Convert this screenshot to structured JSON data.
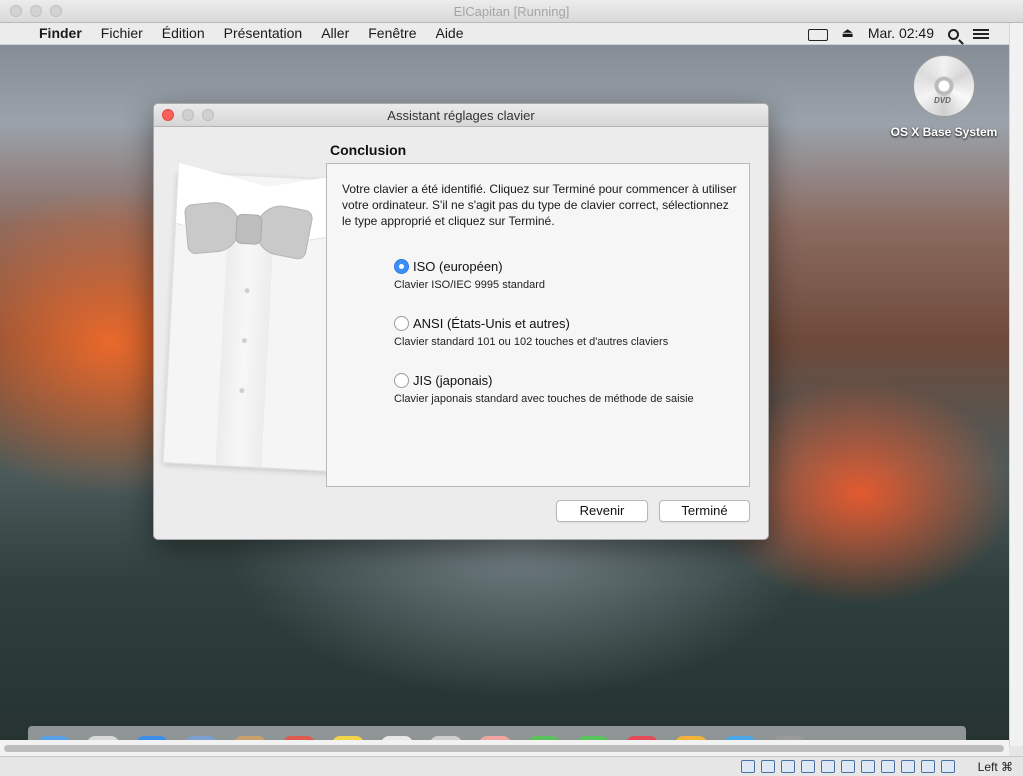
{
  "host": {
    "window_title": "ElCapitan [Running]",
    "hostkey_label": "Left ⌘"
  },
  "menubar": {
    "apple_glyph": "",
    "items": [
      "Finder",
      "Fichier",
      "Édition",
      "Présentation",
      "Aller",
      "Fenêtre",
      "Aide"
    ],
    "clock": "Mar. 02:49",
    "status_icons": [
      "display-mirroring-icon",
      "eject-icon",
      "search-icon",
      "notification-list-icon"
    ]
  },
  "desktop": {
    "dvd_label": "OS X Base System",
    "dvd_disc_text": "DVD"
  },
  "dialog": {
    "title": "Assistant réglages clavier",
    "section_title": "Conclusion",
    "intro": "Votre clavier a été identifié. Cliquez sur Terminé pour commencer à utiliser votre ordinateur. S'il ne s'agit pas du type de clavier correct, sélectionnez le type approprié et cliquez sur Terminé.",
    "options": [
      {
        "label": "ISO (européen)",
        "desc": "Clavier ISO/IEC 9995 standard",
        "selected": true
      },
      {
        "label": "ANSI (États-Unis et autres)",
        "desc": "Clavier standard 101 ou 102 touches et d'autres claviers",
        "selected": false
      },
      {
        "label": "JIS (japonais)",
        "desc": "Clavier japonais standard avec touches de méthode de saisie",
        "selected": false
      }
    ],
    "back_label": "Revenir",
    "done_label": "Terminé"
  },
  "colors": {
    "accent": "#3b8ff5",
    "close_button": "#fc605c"
  }
}
